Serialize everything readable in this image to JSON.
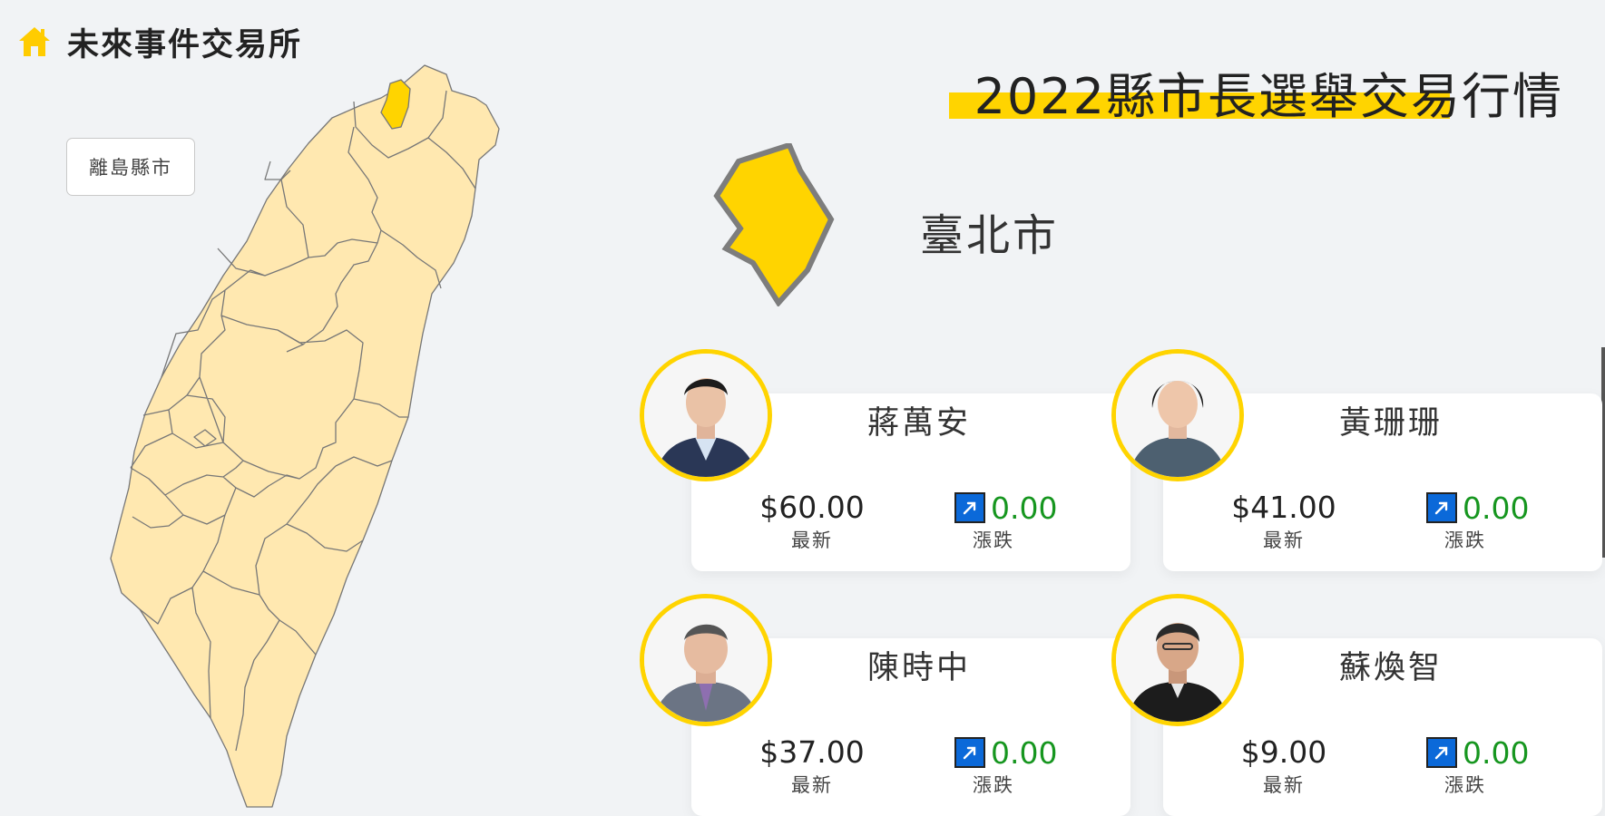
{
  "brand": {
    "title": "未來事件交易所",
    "icon": "home-icon",
    "icon_color": "#ffcc00"
  },
  "island_button": {
    "label": "離島縣市"
  },
  "page": {
    "title": "2022縣市長選舉交易行情",
    "accent": "#ffd400"
  },
  "county": {
    "name": "臺北市",
    "fill": "#ffd400",
    "stroke": "#7d7d7d"
  },
  "map": {
    "fill": "#ffe8b0",
    "stroke": "#777777",
    "highlight": "#ffd400"
  },
  "candidates": [
    {
      "name": "蔣萬安",
      "price": "$60.00",
      "price_label": "最新",
      "change": "0.00",
      "change_label": "漲跌",
      "change_icon": "arrow-up-right-icon"
    },
    {
      "name": "黃珊珊",
      "price": "$41.00",
      "price_label": "最新",
      "change": "0.00",
      "change_label": "漲跌",
      "change_icon": "arrow-up-right-icon"
    },
    {
      "name": "陳時中",
      "price": "$37.00",
      "price_label": "最新",
      "change": "0.00",
      "change_label": "漲跌",
      "change_icon": "arrow-up-right-icon"
    },
    {
      "name": "蘇煥智",
      "price": "$9.00",
      "price_label": "最新",
      "change": "0.00",
      "change_label": "漲跌",
      "change_icon": "arrow-up-right-icon"
    }
  ],
  "colors": {
    "change_positive": "#16961f",
    "arrow_bg": "#0b69d9"
  }
}
